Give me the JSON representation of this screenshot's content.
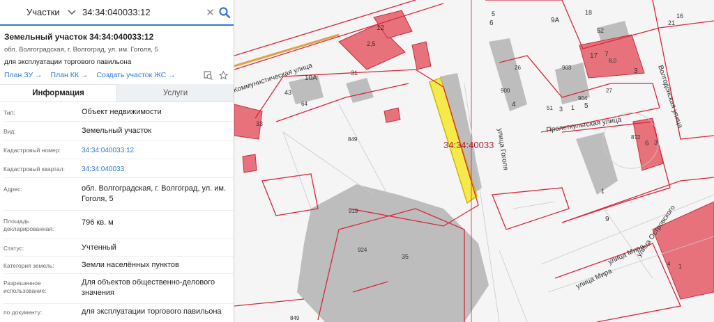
{
  "search": {
    "category": "Участки",
    "query": "34:34:040033:12"
  },
  "parcel": {
    "title": "Земельный участок 34:34:040033:12",
    "address_short": "обл. Волгоградская, г. Волгоград, ул. им. Гоголя, 5",
    "purpose_short": "для эксплуатации торгового павильона",
    "links": [
      "План ЗУ →",
      "План КК →",
      "Создать участок ЖС →"
    ]
  },
  "tabs": [
    "Информация",
    "Услуги"
  ],
  "info": [
    {
      "label": "Тип:",
      "value": "Объект недвижимости"
    },
    {
      "label": "Вид:",
      "value": "Земельный участок"
    },
    {
      "label": "Кадастровый номер:",
      "value": "34:34:040033:12"
    },
    {
      "label": "Кадастровый квартал:",
      "value": "34:34:040033"
    },
    {
      "label": "Адрес:",
      "value": "обл. Волгоградская, г. Волгоград, ул. им. Гоголя, 5"
    },
    {
      "label": "Площадь декларированная:",
      "value": "796 кв. м"
    },
    {
      "label": "Статус:",
      "value": "Учтенный"
    },
    {
      "label": "Категория земель:",
      "value": "Земли населённых пунктов"
    },
    {
      "label": "Разрешенное использование:",
      "value": "Для объектов общественно-делового значения"
    },
    {
      "label": "по документу:",
      "value": "для эксплуатации торгового павильона"
    }
  ],
  "map": {
    "highlight_label": "34:34:40033",
    "streets": [
      "Коммунистическая улица",
      "Пролеткультская улица",
      "улица Гоголя",
      "Волгодонская улица",
      "улица Мира",
      "улица Мира",
      "улица Островского"
    ],
    "labels": [
      "5",
      "6",
      "18",
      "9А",
      "16",
      "21",
      "12",
      "52",
      "2,5",
      "17",
      "7",
      "8,0",
      "26",
      "903",
      "3",
      "10А",
      "31",
      "43",
      "64",
      "900",
      "27",
      "51",
      "904",
      "5",
      "3",
      "1",
      "4",
      "872",
      "6",
      "3",
      "33",
      "849",
      "919",
      "924",
      "35",
      "1",
      "9",
      "849",
      "4",
      "1"
    ]
  },
  "colors": {
    "accent": "#2e78d2",
    "parcel_fill": "#e8727c",
    "boundary": "#d8263a",
    "highlight": "#f6e94a",
    "building": "#bdbdbd"
  }
}
